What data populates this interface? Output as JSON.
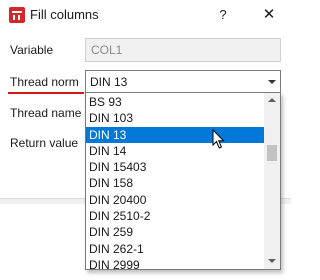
{
  "window": {
    "title": "Fill columns",
    "help_label": "?",
    "close_label": "✕",
    "app_icon": "app-logo-icon"
  },
  "form": {
    "variable_label": "Variable",
    "variable_value": "COL1",
    "thread_norm_label": "Thread norm",
    "thread_norm_value": "DIN 13",
    "thread_name_label": "Thread name",
    "return_value_label": "Return value"
  },
  "dropdown": {
    "items": [
      "BS 93",
      "DIN 103",
      "DIN 13",
      "DIN 14",
      "DIN 15403",
      "DIN 158",
      "DIN 20400",
      "DIN 2510-2",
      "DIN 259",
      "DIN 262-1",
      "DIN 2999"
    ],
    "selected_index": 2
  },
  "colors": {
    "selection": "#0078d7",
    "underline_accent": "#d9161c",
    "app_icon": "#d7262b"
  }
}
